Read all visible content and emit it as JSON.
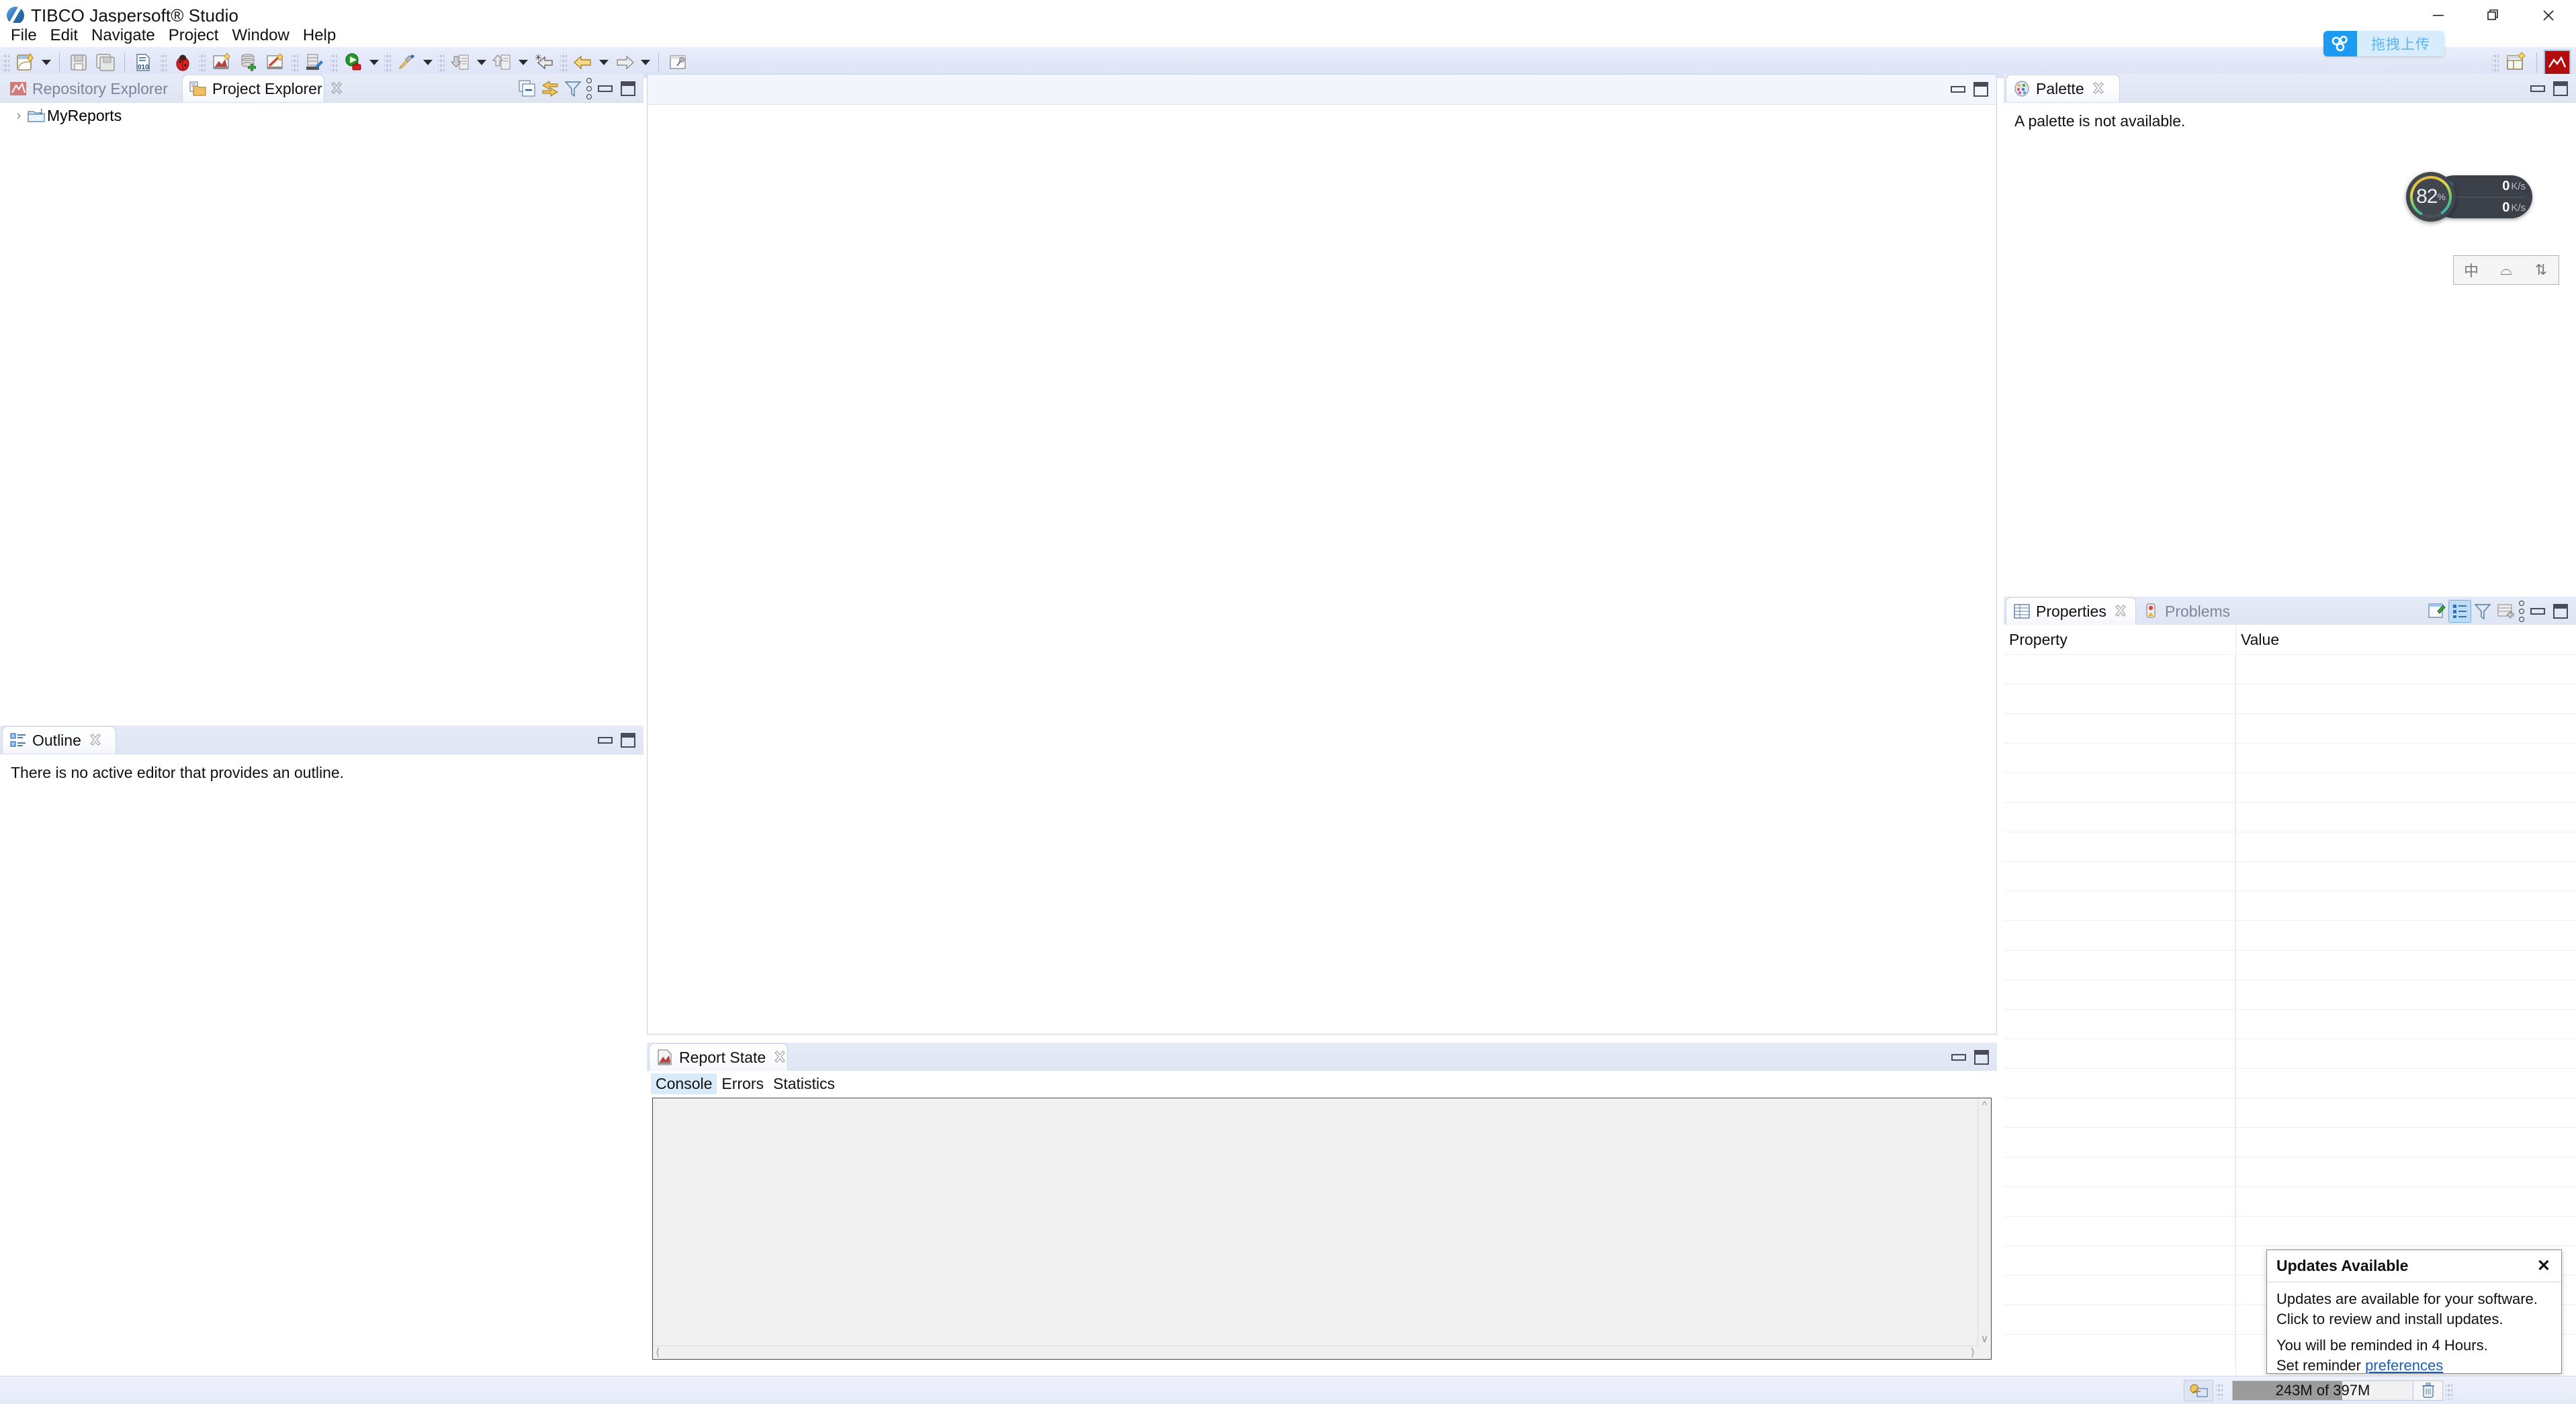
{
  "window": {
    "title": "TIBCO Jaspersoft® Studio",
    "app_icon": "jaspersoft-icon",
    "minimize": "minimize-button",
    "maximize": "restore-button",
    "close": "close-button"
  },
  "menubar": {
    "items": [
      "File",
      "Edit",
      "Navigate",
      "Project",
      "Window",
      "Help"
    ]
  },
  "toolbar": {
    "groups": [
      {
        "buttons": [
          {
            "name": "new-report-icon",
            "glyph": "new"
          },
          {
            "name": "new-dropdown-arrow",
            "glyph": "arrow"
          }
        ]
      },
      {
        "buttons": [
          {
            "name": "save-icon",
            "glyph": "save"
          },
          {
            "name": "save-all-icon",
            "glyph": "saveall"
          }
        ]
      },
      {
        "buttons": [
          {
            "name": "compile-report-icon",
            "glyph": "010"
          },
          {
            "name": "debug-icon",
            "glyph": "bug"
          },
          {
            "name": "new-jasper-report-icon",
            "glyph": "report"
          },
          {
            "name": "new-data-adapter-icon",
            "glyph": "db"
          },
          {
            "name": "new-style-icon",
            "glyph": "wand"
          }
        ]
      },
      {
        "buttons": [
          {
            "name": "publish-to-server-icon",
            "glyph": "publish"
          }
        ]
      },
      {
        "buttons": [
          {
            "name": "run-report-icon",
            "glyph": "run"
          },
          {
            "name": "run-dropdown-arrow",
            "glyph": "arrow"
          }
        ]
      },
      {
        "buttons": [
          {
            "name": "preview-icon",
            "glyph": "pencil"
          },
          {
            "name": "preview-dropdown-arrow",
            "glyph": "arrow"
          }
        ]
      },
      {
        "buttons": [
          {
            "name": "import-icon",
            "glyph": "import"
          },
          {
            "name": "import-dropdown-arrow",
            "glyph": "arrow"
          },
          {
            "name": "export-icon",
            "glyph": "export"
          },
          {
            "name": "export-dropdown-arrow",
            "glyph": "arrow"
          },
          {
            "name": "back-to-icon",
            "glyph": "backto"
          }
        ]
      },
      {
        "buttons": [
          {
            "name": "back-navigation-icon",
            "glyph": "back"
          },
          {
            "name": "back-dropdown-arrow",
            "glyph": "arrow"
          },
          {
            "name": "forward-navigation-icon",
            "glyph": "forward"
          },
          {
            "name": "forward-dropdown-arrow",
            "glyph": "arrow"
          }
        ]
      },
      {
        "buttons": [
          {
            "name": "pin-editor-icon",
            "glyph": "pin"
          }
        ]
      }
    ],
    "perspective_open": "open-perspective-icon",
    "perspective_active": "jaspersoft-perspective-icon"
  },
  "cloud_upload": {
    "label": "拖拽上传",
    "icon": "cloud-upload-icon",
    "icon_bg": "#1e9bf0",
    "label_bg": "#d7edfd",
    "label_color": "#63b4ef"
  },
  "project_explorer": {
    "tabs": [
      {
        "label": "Repository Explorer",
        "icon": "repository-icon",
        "active": false,
        "closable": false
      },
      {
        "label": "Project Explorer",
        "icon": "project-folder-icon",
        "active": true,
        "closable": true
      }
    ],
    "tools": [
      {
        "name": "collapse-all-icon"
      },
      {
        "name": "link-with-editor-icon"
      },
      {
        "name": "filter-icon"
      },
      {
        "name": "view-menu-icon"
      },
      {
        "name": "minimize-panel-icon"
      },
      {
        "name": "maximize-panel-icon"
      }
    ],
    "tree": [
      {
        "label": "MyReports",
        "icon": "jasper-project-folder-icon",
        "expanded": false
      }
    ]
  },
  "outline": {
    "tab_label": "Outline",
    "tab_icon": "outline-icon",
    "message": "There is no active editor that provides an outline.",
    "tools": [
      {
        "name": "minimize-panel-icon"
      },
      {
        "name": "maximize-panel-icon"
      }
    ]
  },
  "editor": {
    "tools": [
      {
        "name": "minimize-panel-icon"
      },
      {
        "name": "maximize-panel-icon"
      }
    ]
  },
  "report_state": {
    "tab_label": "Report State",
    "tab_icon": "report-state-icon",
    "subtabs": [
      {
        "label": "Console",
        "selected": true
      },
      {
        "label": "Errors",
        "selected": false
      },
      {
        "label": "Statistics",
        "selected": false
      }
    ],
    "console_text": "",
    "tools": [
      {
        "name": "minimize-panel-icon"
      },
      {
        "name": "maximize-panel-icon"
      }
    ]
  },
  "palette": {
    "tab_label": "Palette",
    "tab_icon": "palette-icon",
    "message": "A palette is not available.",
    "tools": [
      {
        "name": "minimize-panel-icon"
      },
      {
        "name": "maximize-panel-icon"
      }
    ]
  },
  "properties": {
    "tabs": [
      {
        "label": "Properties",
        "icon": "properties-table-icon",
        "active": true,
        "closable": true
      },
      {
        "label": "Problems",
        "icon": "problems-icon",
        "active": false,
        "closable": false
      }
    ],
    "tools": [
      {
        "name": "new-property-icon",
        "active": false
      },
      {
        "name": "show-categories-icon",
        "active": true
      },
      {
        "name": "filter-icon",
        "active": false
      },
      {
        "name": "restore-defaults-icon",
        "active": false
      },
      {
        "name": "view-menu-icon",
        "active": false
      },
      {
        "name": "minimize-panel-icon",
        "active": false
      },
      {
        "name": "maximize-panel-icon",
        "active": false
      }
    ],
    "columns": [
      "Property",
      "Value"
    ],
    "rows": []
  },
  "perf_widget": {
    "cpu_percent": "82",
    "percent_symbol": "%",
    "upload_value": "0",
    "upload_unit": "K/s",
    "download_value": "0",
    "download_unit": "K/s",
    "upload_icon": "arrow-up-icon",
    "download_icon": "arrow-down-icon",
    "ring_colors": [
      "#e8a33d",
      "#d9d94a",
      "#54c27a",
      "#3fc7c7",
      "#2aa8d8"
    ]
  },
  "ime_bar": {
    "keys": [
      "中",
      "⌓",
      "⇅"
    ]
  },
  "updates_popup": {
    "title": "Updates Available",
    "close_icon": "close-icon",
    "line1": "Updates are available for your software.",
    "line2": "Click to review and install updates.",
    "line3": "You will be reminded in 4 Hours.",
    "line4_prefix": "Set reminder ",
    "link_text": "preferences"
  },
  "statusbar": {
    "memory_text": "243M of 397M",
    "memory_used_pct": 61,
    "heap_icon": "heap-status-icon",
    "trash_icon": "trash-icon"
  }
}
